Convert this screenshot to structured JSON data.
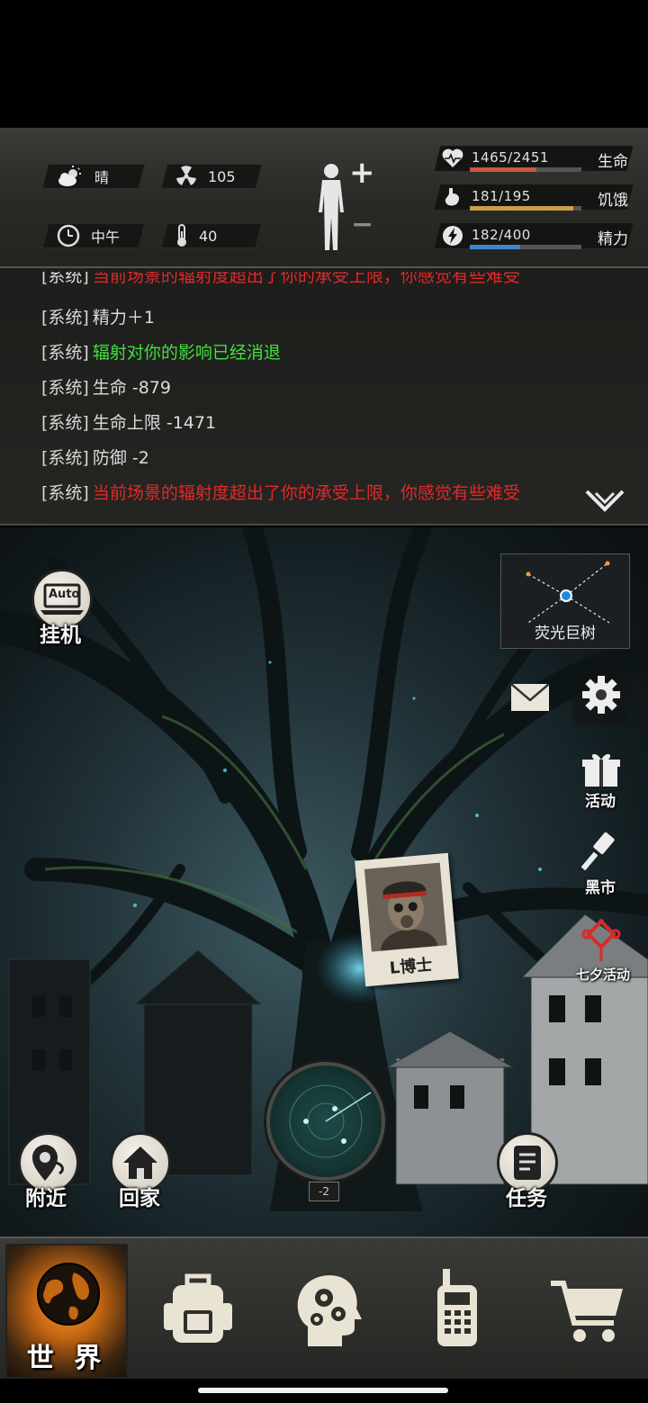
{
  "status": {
    "weather": {
      "icon": "cloud-sun-icon",
      "label": "晴"
    },
    "radiation": {
      "icon": "radiation-icon",
      "value": "105"
    },
    "time": {
      "icon": "clock-icon",
      "label": "中午"
    },
    "temperature": {
      "icon": "thermometer-icon",
      "value": "40"
    },
    "body": {
      "icon": "human-body-icon",
      "plus": "+",
      "minus": "−"
    },
    "stats": [
      {
        "name": "life",
        "icon": "heart-icon",
        "value_text": "1465/2451",
        "label": "生命",
        "fraction": 0.598,
        "color": "#c9553f"
      },
      {
        "name": "hunger",
        "icon": "stomach-icon",
        "value_text": "181/195",
        "label": "饥饿",
        "fraction": 0.928,
        "color": "#c9a04a"
      },
      {
        "name": "energy",
        "icon": "lightning-icon",
        "value_text": "182/400",
        "label": "精力",
        "fraction": 0.455,
        "color": "#3f86c9"
      }
    ]
  },
  "log": {
    "tag": "[系统]",
    "lines": [
      {
        "text": "当前场景的辐射度超出了你的承受上限，你感觉有些难受",
        "color": "#e02a2a"
      },
      {
        "text": "精力＋1",
        "color": "#dcdcdc"
      },
      {
        "text": "辐射对你的影响已经消退",
        "color": "#3fe03f"
      },
      {
        "text": "生命 -879",
        "color": "#dcdcdc"
      },
      {
        "text": "生命上限 -1471",
        "color": "#dcdcdc"
      },
      {
        "text": "防御 -2",
        "color": "#dcdcdc"
      },
      {
        "text": "当前场景的辐射度超出了你的承受上限，你感觉有些难受",
        "color": "#e02a2a"
      }
    ],
    "collapse_icon": "double-chevron-down-icon"
  },
  "scene": {
    "auto_button": {
      "badge": "Auto",
      "label": "挂机"
    },
    "minimap": {
      "location": "荧光巨树"
    },
    "side_buttons": [
      {
        "name": "mail",
        "icon": "envelope-icon",
        "label": ""
      },
      {
        "name": "settings",
        "icon": "gear-icon",
        "label": ""
      },
      {
        "name": "events",
        "icon": "gift-icon",
        "label": "活动"
      },
      {
        "name": "black-market",
        "icon": "hammer-icon",
        "label": "黑市"
      },
      {
        "name": "qixi-event",
        "icon": "chinese-knot-icon",
        "label": "七夕活动"
      }
    ],
    "npc": {
      "name": "L博士"
    },
    "radar": {
      "level": "-2"
    },
    "bottom_buttons": [
      {
        "name": "nearby",
        "icon": "location-pin-icon",
        "label": "附近"
      },
      {
        "name": "home",
        "icon": "house-icon",
        "label": "回家"
      },
      {
        "name": "tasks",
        "icon": "scroll-icon",
        "label": "任务"
      }
    ]
  },
  "nav": {
    "tabs": [
      {
        "name": "world",
        "icon": "globe-icon",
        "label": "世 界",
        "active": true
      },
      {
        "name": "backpack",
        "icon": "backpack-icon",
        "label": ""
      },
      {
        "name": "skills",
        "icon": "head-gears-icon",
        "label": ""
      },
      {
        "name": "radio",
        "icon": "walkie-talkie-icon",
        "label": ""
      },
      {
        "name": "shop",
        "icon": "shopping-cart-icon",
        "label": ""
      }
    ]
  }
}
